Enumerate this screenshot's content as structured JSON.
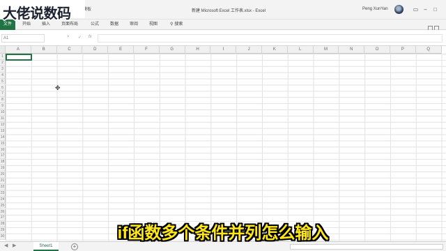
{
  "watermark": "大佬说数码",
  "subtitle": "if函数多个条件并列怎么输入",
  "titlebar": {
    "quick_access_label": "用模板",
    "document_title": "新建 Microsoft Excel 工作表.xlsx  -  Excel",
    "user_name": "Peng XunYan"
  },
  "ribbon": {
    "file_tab": "文件",
    "tabs": [
      "开始",
      "插入",
      "页面布局",
      "公式",
      "数据",
      "审阅",
      "视图"
    ],
    "search_label": "搜索"
  },
  "formula_bar": {
    "name_box": "A1",
    "cancel_glyph": "×",
    "enter_glyph": "✓",
    "fx_label": "fx",
    "value": ""
  },
  "grid": {
    "columns": [
      "A",
      "B",
      "C",
      "D",
      "E",
      "F",
      "G",
      "H",
      "I",
      "J",
      "K",
      "L",
      "M",
      "N",
      "O",
      "P",
      "Q"
    ],
    "rows": [
      "1",
      "2",
      "3",
      "4",
      "5",
      "6",
      "7",
      "8",
      "9",
      "10",
      "11",
      "12",
      "13",
      "14",
      "15",
      "16",
      "17",
      "18",
      "19",
      "20",
      "21",
      "22",
      "23",
      "24",
      "25",
      "26",
      "27",
      "28",
      "29",
      "30"
    ]
  },
  "sheets": {
    "tabs": [
      "Sheet1"
    ],
    "add_glyph": "+"
  },
  "colors": {
    "excel_green": "#217346",
    "subtitle_yellow": "#ffe71a"
  }
}
